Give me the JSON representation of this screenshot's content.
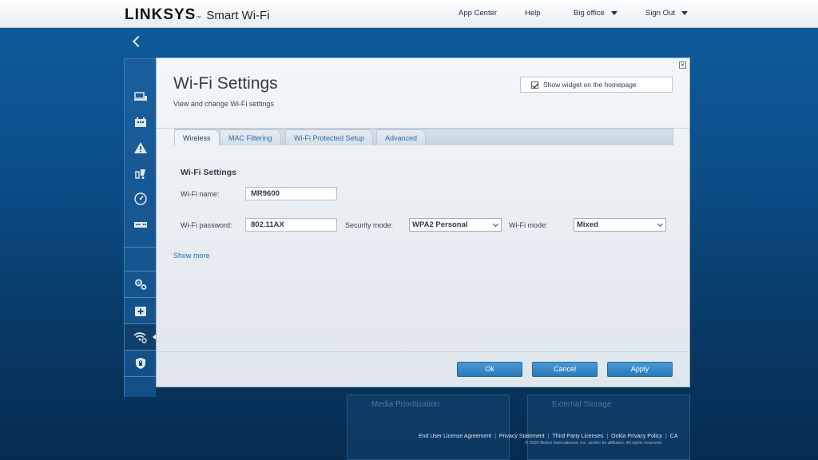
{
  "header": {
    "brand": "LINKSYS",
    "trademark": "™",
    "product": "Smart Wi-Fi",
    "nav": {
      "app_center": "App Center",
      "help": "Help",
      "location": "Big office",
      "sign_out": "Sign Out"
    }
  },
  "sidebar": {
    "items": [
      {
        "icon": "devices-icon"
      },
      {
        "icon": "network-map-icon"
      },
      {
        "icon": "alert-icon"
      },
      {
        "icon": "parental-controls-icon"
      },
      {
        "icon": "speed-test-icon"
      },
      {
        "icon": "router-icon"
      },
      {
        "icon": "settings-gears-icon"
      },
      {
        "icon": "backup-add-icon"
      },
      {
        "icon": "wifi-settings-icon",
        "active": true
      },
      {
        "icon": "security-shield-icon"
      }
    ]
  },
  "background_widgets": {
    "left_title": "Media Prioritization",
    "right_title": "External Storage"
  },
  "footer": {
    "links": [
      "End User License Agreement",
      "Privacy Statement",
      "Third Party Licenses",
      "Ookla Privacy Policy",
      "CA"
    ],
    "copyright": "© 2020 Belkin International, Inc. and/or its affiliates. All rights reserved."
  },
  "modal": {
    "title": "Wi-Fi Settings",
    "subtitle": "View and change Wi-Fi settings",
    "show_widget_label": "Show widget on the homepage",
    "show_widget_checked": true,
    "tabs": [
      "Wireless",
      "MAC Filtering",
      "Wi-Fi Protected Setup",
      "Advanced"
    ],
    "active_tab": "Wireless",
    "section_title": "Wi-Fi Settings",
    "fields": {
      "name_label": "Wi-Fi name:",
      "name_value": "MR9600",
      "password_label": "Wi-Fi password:",
      "password_value": "802.11AX",
      "security_label": "Security mode:",
      "security_value": "WPA2 Personal",
      "mode_label": "Wi-Fi mode:",
      "mode_value": "Mixed"
    },
    "show_more": "Show more",
    "buttons": {
      "ok": "Ok",
      "cancel": "Cancel",
      "apply": "Apply"
    }
  },
  "colors": {
    "accent_blue": "#2a78b8",
    "link_blue": "#2a6ea8",
    "page_bg": "#0b4d86"
  }
}
